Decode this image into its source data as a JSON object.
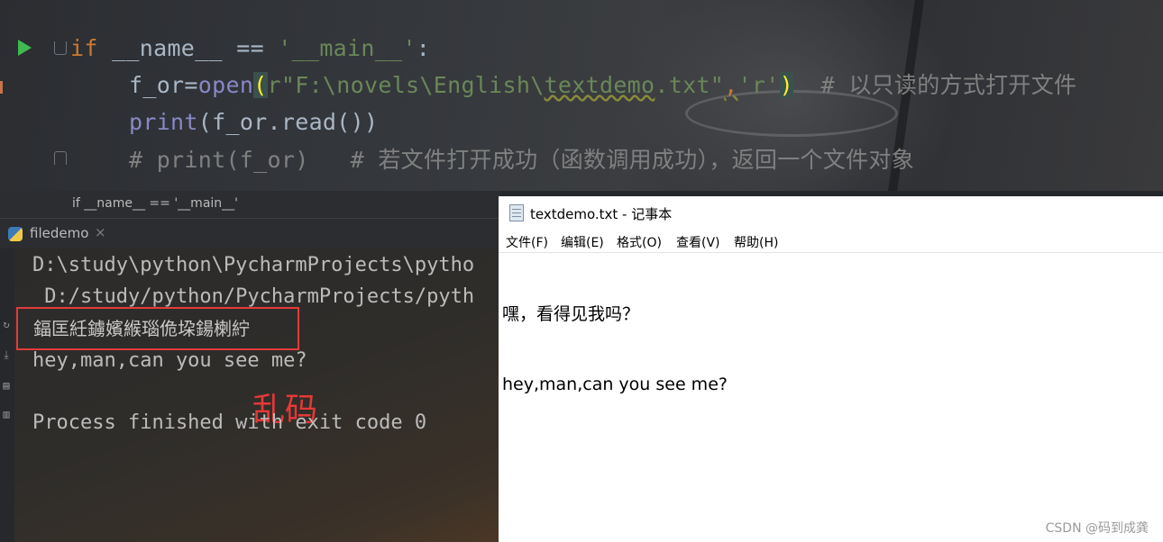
{
  "editor": {
    "code_lines": [
      {
        "parts": [
          {
            "t": "if",
            "c": "kw"
          },
          {
            "t": " __name__ == ",
            "c": ""
          },
          {
            "t": "'__main__'",
            "c": "str"
          },
          {
            "t": ":",
            "c": ""
          }
        ]
      },
      {
        "parts": [
          {
            "t": "f_or=",
            "c": ""
          },
          {
            "t": "open",
            "c": "fn"
          },
          {
            "t": "(",
            "c": "hl-paren"
          },
          {
            "t": "r\"F:\\novels\\English\\",
            "c": "str"
          },
          {
            "t": "textdemo",
            "c": "str squig"
          },
          {
            "t": ".txt\"",
            "c": "str"
          },
          {
            "t": ",",
            "c": "kw squig"
          },
          {
            "t": "'r'",
            "c": "str"
          },
          {
            "t": ")",
            "c": "hl-paren"
          },
          {
            "t": "  # 以只读的方式打开文件",
            "c": "cmt"
          }
        ]
      },
      {
        "parts": [
          {
            "t": "print",
            "c": "fn"
          },
          {
            "t": "(f_or.read())",
            "c": ""
          }
        ]
      },
      {
        "parts": [
          {
            "t": "# print(f_or)   # 若文件打开成功（函数调用成功），返回一个文件对象",
            "c": "cmt"
          }
        ]
      }
    ],
    "breadcrumb": "if __name__ == '__main__'"
  },
  "run_panel": {
    "tab_label": "filedemo",
    "tab_close": "×",
    "lines": {
      "path1": "D:\\study\\python\\PycharmProjects\\pytho",
      "path2": " D:/study/python/PycharmProjects/pyth",
      "garbled": "鍢匡紝鐪嬪緱瑙佹垜鍚楋紵",
      "english": "hey,man,can you see me?",
      "exit": "Process finished with exit code 0"
    },
    "annotation": "乱码",
    "side_icons": [
      "rerun-icon",
      "download-icon",
      "print-icon",
      "delete-icon"
    ]
  },
  "notepad": {
    "title": "textdemo.txt - 记事本",
    "menu": [
      "文件(F)",
      "编辑(E)",
      "格式(O)",
      "查看(V)",
      "帮助(H)"
    ],
    "content": [
      "嘿，看得见我吗？",
      "hey,man,can you see me?"
    ]
  },
  "watermark": "CSDN @码到成龚",
  "colors": {
    "annotation": "#e53935",
    "run_icon": "#3fb950",
    "box": "#e23b3b"
  }
}
